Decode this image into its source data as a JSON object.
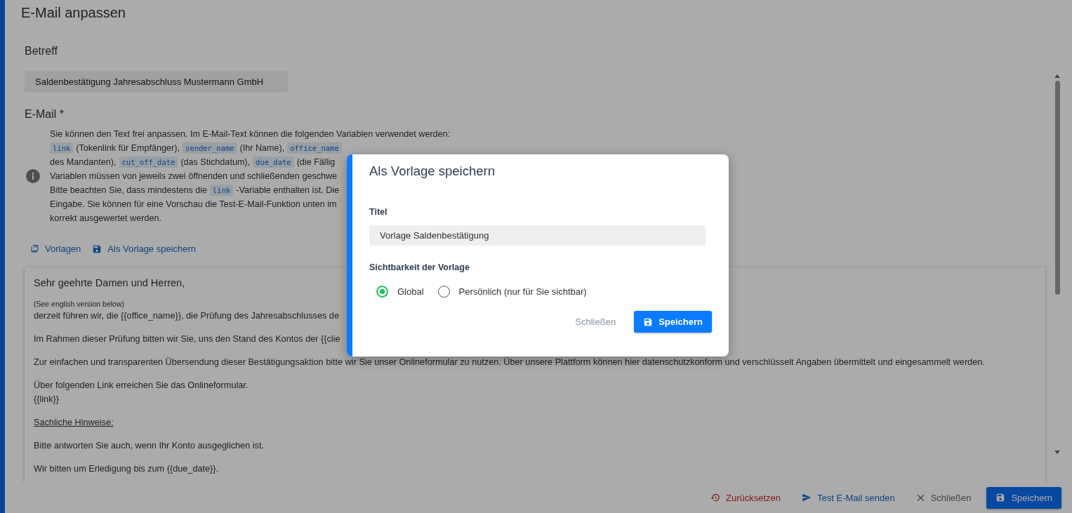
{
  "page": {
    "title": "E-Mail anpassen"
  },
  "subject": {
    "label": "Betreff",
    "value": "Saldenbestätigung Jahresabschluss Mustermann GmbH"
  },
  "email": {
    "label": "E-Mail *",
    "info_lines": [
      [
        {
          "kind": "text",
          "text": "Sie können den Text frei anpassen. Im E-Mail-Text können die folgenden Variablen verwendet werden:"
        }
      ],
      [
        {
          "kind": "variable",
          "text": "link"
        },
        {
          "kind": "text",
          "text": "(Tokenlink für Empfänger),"
        },
        {
          "kind": "variable",
          "text": "sender_name"
        },
        {
          "kind": "text",
          "text": "(Ihr Name),"
        },
        {
          "kind": "variable",
          "text": "office_name"
        }
      ],
      [
        {
          "kind": "text",
          "text": "des Mandanten),"
        },
        {
          "kind": "variable",
          "text": "cut_off_date"
        },
        {
          "kind": "text",
          "text": "(das Stichdatum),"
        },
        {
          "kind": "variable",
          "text": "due_date"
        },
        {
          "kind": "text",
          "text": "(die Fällig"
        }
      ],
      [
        {
          "kind": "text",
          "text": "Variablen müssen von jeweils zwei öffnenden und schließenden geschwe"
        }
      ],
      [
        {
          "kind": "text",
          "text": "Bitte beachten Sie, dass mindestens die"
        },
        {
          "kind": "variable",
          "text": "link"
        },
        {
          "kind": "text",
          "text": "-Variable enthalten ist. Die"
        }
      ],
      [
        {
          "kind": "text",
          "text": "Eingabe. Sie können für eine Vorschau die Test-E-Mail-Funktion unten im"
        }
      ],
      [
        {
          "kind": "text",
          "text": "korrekt ausgewertet werden."
        }
      ]
    ],
    "actions": [
      {
        "label": "Vorlagen",
        "kind": "templates"
      },
      {
        "label": "Als Vorlage speichern",
        "kind": "save"
      }
    ],
    "body": [
      {
        "lines": [
          {
            "kind": "large",
            "text": "Sehr geehrte Damen und Herren,"
          }
        ]
      },
      {
        "lines": [
          {
            "kind": "small",
            "text": "(See english version below)"
          },
          {
            "kind": "normal",
            "text": "derzeit führen wir, die {{office_name}}, die Prüfung des Jahresabschlusses de"
          }
        ]
      },
      {
        "lines": [
          {
            "kind": "normal",
            "text": "Im Rahmen dieser Prüfung bitten wir Sie, uns den Stand des Kontos der {{clie"
          }
        ]
      },
      {
        "lines": [
          {
            "kind": "normal",
            "text": "Zur einfachen und transparenten Übersendung dieser Bestätigungsaktion bitte wir Sie unser Onlineformular zu nutzen. Über unsere Plattform können hier datenschutzkonform und verschlüsselt Angaben übermittelt und eingesammelt werden."
          }
        ]
      },
      {
        "lines": [
          {
            "kind": "normal",
            "text": "Über folgenden Link erreichen Sie das Onlineformular."
          },
          {
            "kind": "normal",
            "text": "{{link}}"
          }
        ]
      },
      {
        "lines": [
          {
            "kind": "underline",
            "text": "Sachliche Hinweise:"
          }
        ]
      },
      {
        "lines": [
          {
            "kind": "normal",
            "text": "Bitte antworten Sie auch, wenn Ihr Konto ausgeglichen ist."
          }
        ]
      },
      {
        "lines": [
          {
            "kind": "normal",
            "text": "Wir bitten um Erledigung bis zum {{due_date}}."
          }
        ]
      }
    ]
  },
  "footer_buttons": [
    {
      "label": "Zurücksetzen",
      "kind": "reset"
    },
    {
      "label": "Test E-Mail senden",
      "kind": "test"
    },
    {
      "label": "Schließen",
      "kind": "close"
    },
    {
      "label": "Speichern",
      "kind": "save"
    }
  ],
  "dialog": {
    "title": "Als Vorlage speichern",
    "title_field": {
      "label": "Titel",
      "value": "Vorlage Saldenbestätigung"
    },
    "visibility": {
      "label": "Sichtbarkeit der Vorlage",
      "options": [
        {
          "label": "Global",
          "selected": true
        },
        {
          "label": "Persönlich (nur für Sie sichtbar)",
          "selected": false
        }
      ]
    },
    "buttons": [
      {
        "label": "Schließen",
        "kind": "close"
      },
      {
        "label": "Speichern",
        "kind": "save"
      }
    ]
  }
}
